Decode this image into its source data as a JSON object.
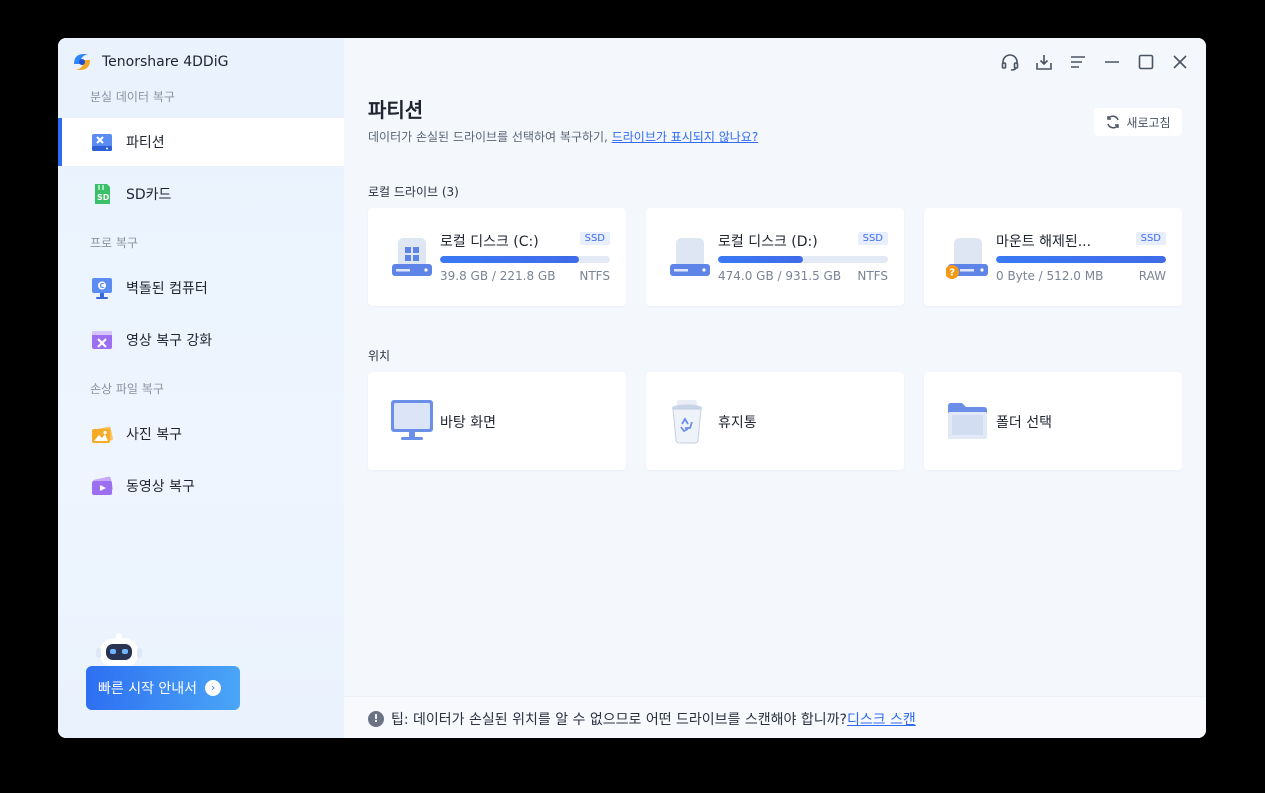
{
  "app": {
    "title": "Tenorshare 4DDiG"
  },
  "sidebar": {
    "sections": [
      {
        "label": "분실 데이터 복구"
      },
      {
        "label": "프로 복구"
      },
      {
        "label": "손상 파일 복구"
      }
    ],
    "items": [
      {
        "label": "파티션",
        "icon": "partition-icon",
        "active": true
      },
      {
        "label": "SD카드",
        "icon": "sd-card-icon"
      },
      {
        "label": "벽돌된 컴퓨터",
        "icon": "crashed-computer-icon"
      },
      {
        "label": "영상 복구 강화",
        "icon": "video-repair-icon"
      },
      {
        "label": "사진 복구",
        "icon": "photo-icon"
      },
      {
        "label": "동영상 복구",
        "icon": "video-icon"
      }
    ],
    "quick_start_label": "빠른 시작 안내서"
  },
  "header": {
    "icons": [
      "headset-icon",
      "download-icon",
      "menu-icon",
      "minimize-icon",
      "maximize-icon",
      "close-icon"
    ]
  },
  "main": {
    "title": "파티션",
    "subtitle": "데이터가 손실된 드라이브를 선택하여 복구하기,",
    "subtitle_link": "드라이브가 표시되지 않나요?",
    "refresh_label": "새로고침",
    "local_drives_label": "로컬 드라이브 (3)",
    "drives": [
      {
        "name": "로컬 디스크 (C:)",
        "badge": "SSD",
        "size": "39.8 GB / 221.8 GB",
        "fs": "NTFS",
        "fill_percent": 82,
        "icon": "windows-drive-icon"
      },
      {
        "name": "로컬 디스크 (D:)",
        "badge": "SSD",
        "size": "474.0 GB / 931.5 GB",
        "fs": "NTFS",
        "fill_percent": 50,
        "icon": "drive-icon"
      },
      {
        "name": "마운트 해제된...",
        "badge": "SSD",
        "size": "0 Byte / 512.0 MB",
        "fs": "RAW",
        "fill_percent": 100,
        "icon": "unknown-drive-icon"
      }
    ],
    "locations_label": "위치",
    "locations": [
      {
        "name": "바탕 화면",
        "icon": "desktop-icon"
      },
      {
        "name": "휴지통",
        "icon": "recycle-bin-icon"
      },
      {
        "name": "폴더 선택",
        "icon": "folder-icon"
      }
    ]
  },
  "tip": {
    "text": "팁: 데이터가 손실된 위치를 알 수 없으므로 어떤 드라이브를 스캔해야 합니까?",
    "link": "디스크 스캔"
  }
}
